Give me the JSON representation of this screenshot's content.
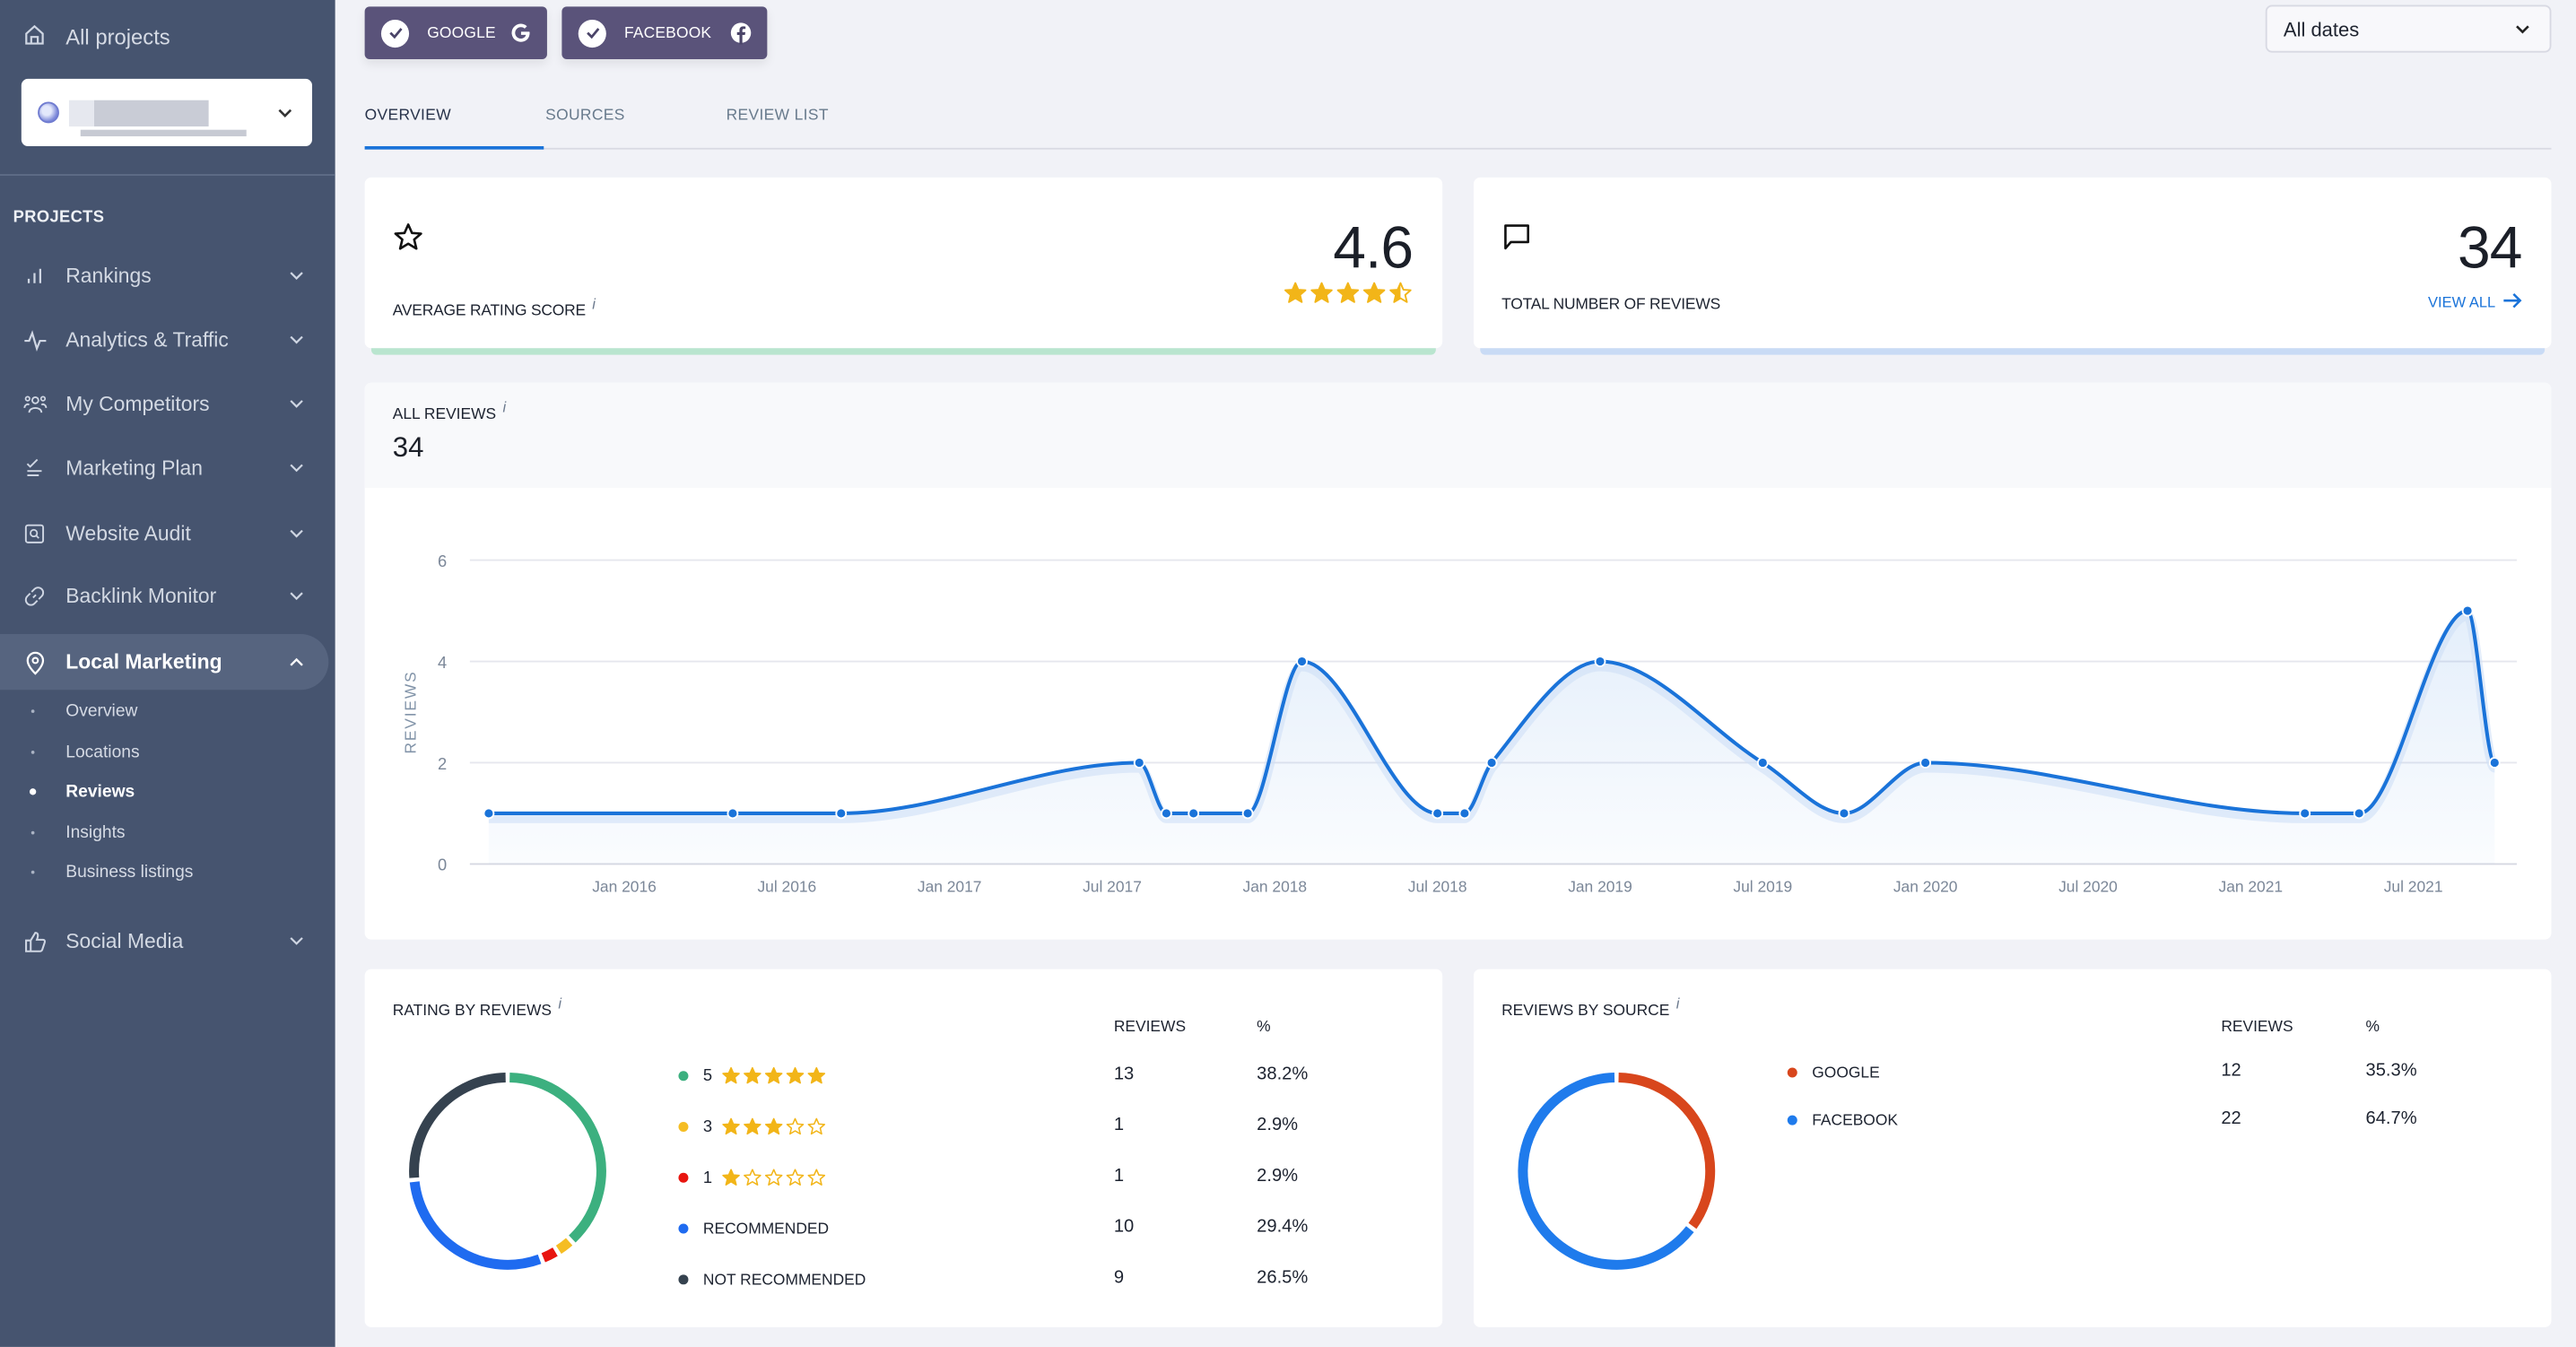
{
  "sidebar": {
    "all_projects": "All projects",
    "project_select": {
      "value": ""
    },
    "section_label": "PROJECTS",
    "items": [
      {
        "label": "Rankings",
        "icon": "bar-chart-icon"
      },
      {
        "label": "Analytics & Traffic",
        "icon": "activity-icon"
      },
      {
        "label": "My Competitors",
        "icon": "users-icon"
      },
      {
        "label": "Marketing Plan",
        "icon": "checklist-icon"
      },
      {
        "label": "Website Audit",
        "icon": "audit-search-icon"
      },
      {
        "label": "Backlink Monitor",
        "icon": "link-icon"
      },
      {
        "label": "Local Marketing",
        "icon": "map-pin-icon",
        "expanded": true
      },
      {
        "label": "Social Media",
        "icon": "thumbs-up-icon"
      }
    ],
    "subitems": [
      {
        "label": "Overview"
      },
      {
        "label": "Locations"
      },
      {
        "label": "Reviews",
        "active": true
      },
      {
        "label": "Insights"
      },
      {
        "label": "Business listings"
      }
    ]
  },
  "filters": {
    "sources": [
      {
        "label": "GOOGLE",
        "checked": true,
        "icon": "google-icon"
      },
      {
        "label": "FACEBOOK",
        "checked": true,
        "icon": "facebook-icon"
      }
    ],
    "date_range": "All dates"
  },
  "tabs": [
    {
      "label": "OVERVIEW",
      "active": true
    },
    {
      "label": "SOURCES"
    },
    {
      "label": "REVIEW LIST"
    }
  ],
  "kpis": {
    "rating": {
      "label": "AVERAGE RATING SCORE",
      "info": "i",
      "value": "4.6",
      "stars": 4.6,
      "accent": "#b9e5cf"
    },
    "total": {
      "label": "TOTAL NUMBER OF REVIEWS",
      "value": "34",
      "link": "VIEW ALL",
      "accent": "#c9dbf5"
    }
  },
  "all_reviews": {
    "title": "ALL REVIEWS",
    "info": "i",
    "total": "34"
  },
  "chart_data": {
    "type": "line",
    "title": "ALL REVIEWS",
    "xlabel": "",
    "ylabel": "REVIEWS",
    "ylim": [
      0,
      6
    ],
    "yticks": [
      0,
      2,
      4,
      6
    ],
    "xticks": [
      "Jan 2016",
      "Jul 2016",
      "Jan 2017",
      "Jul 2017",
      "Jan 2018",
      "Jul 2018",
      "Jan 2019",
      "Jul 2019",
      "Jan 2020",
      "Jul 2020",
      "Jan 2021",
      "Jul 2021"
    ],
    "grid": true,
    "color": "#1a73d9",
    "series": [
      {
        "name": "Reviews",
        "points": [
          {
            "x": "2015-08",
            "y": 1
          },
          {
            "x": "2016-05",
            "y": 1
          },
          {
            "x": "2016-09",
            "y": 1
          },
          {
            "x": "2017-08",
            "y": 2
          },
          {
            "x": "2017-09",
            "y": 1
          },
          {
            "x": "2017-10",
            "y": 1
          },
          {
            "x": "2017-12",
            "y": 1
          },
          {
            "x": "2018-02",
            "y": 4
          },
          {
            "x": "2018-07",
            "y": 1
          },
          {
            "x": "2018-08",
            "y": 1
          },
          {
            "x": "2018-09",
            "y": 2
          },
          {
            "x": "2019-01",
            "y": 4
          },
          {
            "x": "2019-07",
            "y": 2
          },
          {
            "x": "2019-10",
            "y": 1
          },
          {
            "x": "2020-01",
            "y": 2
          },
          {
            "x": "2021-03",
            "y": 1
          },
          {
            "x": "2021-05",
            "y": 1
          },
          {
            "x": "2021-09",
            "y": 5
          },
          {
            "x": "2021-10",
            "y": 2
          }
        ]
      }
    ]
  },
  "rating_by_reviews": {
    "title": "RATING BY REVIEWS",
    "info": "i",
    "col_reviews": "REVIEWS",
    "col_pct": "%",
    "rows": [
      {
        "label": "5",
        "stars": 5,
        "count": "13",
        "pct": "38.2%",
        "value": 13,
        "color": "#3cb07f"
      },
      {
        "label": "3",
        "stars": 3,
        "count": "1",
        "pct": "2.9%",
        "value": 1,
        "color": "#f5bd23"
      },
      {
        "label": "1",
        "stars": 1,
        "count": "1",
        "pct": "2.9%",
        "value": 1,
        "color": "#e8150f"
      },
      {
        "label": "RECOMMENDED",
        "count": "10",
        "pct": "29.4%",
        "value": 10,
        "color": "#1f6bf0"
      },
      {
        "label": "NOT RECOMMENDED",
        "count": "9",
        "pct": "26.5%",
        "value": 9,
        "color": "#35424f"
      }
    ]
  },
  "reviews_by_source": {
    "title": "REVIEWS BY SOURCE",
    "info": "i",
    "col_reviews": "REVIEWS",
    "col_pct": "%",
    "rows": [
      {
        "label": "GOOGLE",
        "count": "12",
        "pct": "35.3%",
        "value": 12,
        "color": "#d8461c"
      },
      {
        "label": "FACEBOOK",
        "count": "22",
        "pct": "64.7%",
        "value": 22,
        "color": "#1f7bec"
      }
    ]
  },
  "colors": {
    "sidebar_bg": "#46546f",
    "accent": "#1a73d9",
    "filter_btn": "#5a537a",
    "star": "#f2b518"
  }
}
